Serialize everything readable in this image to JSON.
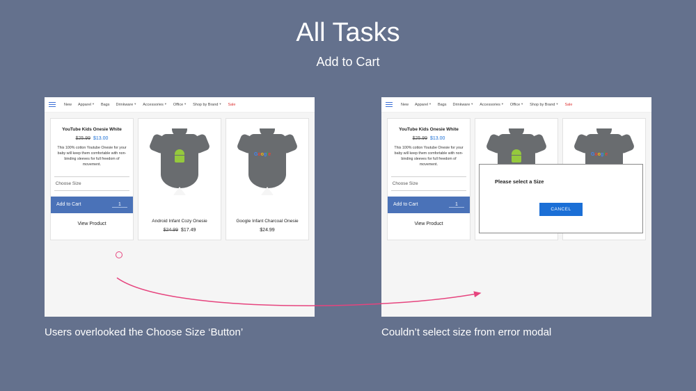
{
  "slide": {
    "title": "All Tasks",
    "subtitle": "Add to Cart"
  },
  "nav": {
    "items": [
      "New",
      "Apparel",
      "Bags",
      "Drinkware",
      "Accessories",
      "Office",
      "Shop by Brand"
    ],
    "sale": "Sale"
  },
  "product_card": {
    "title": "YouTube Kids Onesie White",
    "old_price": "$25.99",
    "new_price": "$13.00",
    "description": "This 100% cotton Youtube Onesie for your baby will keep them comfortable with non-binding sleeves for full freedom of movement.",
    "choose_size_label": "Choose Size",
    "add_to_cart_label": "Add to Cart",
    "qty": "1",
    "view_product_label": "View Product"
  },
  "product2": {
    "name": "Android Infant Cozy Onesie",
    "old_price": "$24.99",
    "new_price": "$17.49"
  },
  "product3": {
    "name": "Google Infant Charcoal Onesie",
    "price": "$24.99"
  },
  "modal": {
    "message": "Please select a Size",
    "cancel": "CANCEL"
  },
  "captions": {
    "left": "Users overlooked the Choose Size ‘Button’",
    "right": "Couldn’t select size from error modal"
  }
}
